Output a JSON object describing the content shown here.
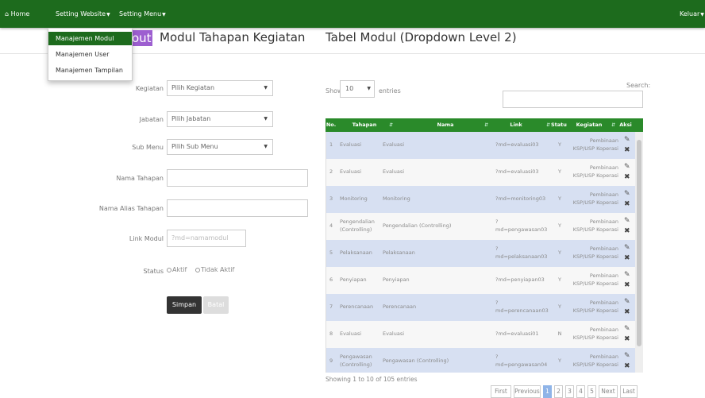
{
  "navbar": {
    "home": "Home",
    "setting_website": "Setting Website",
    "setting_menu": "Setting Menu",
    "logout": "Keluar"
  },
  "dropdown": {
    "items": [
      {
        "label": "Manajemen Modul",
        "active": true
      },
      {
        "label": "Manajemen User",
        "active": false
      },
      {
        "label": "Manajemen Tampilan",
        "active": false
      }
    ]
  },
  "headings": {
    "badge": "out",
    "form_title": "Modul Tahapan Kegiatan",
    "table_title": "Tabel Modul (Dropdown Level 2)"
  },
  "form": {
    "kegiatan_label": "Kegiatan",
    "kegiatan_value": "Pilih Kegiatan",
    "jabatan_label": "Jabatan",
    "jabatan_value": "Pilih Jabatan",
    "submenu_label": "Sub Menu",
    "submenu_value": "Pilih Sub Menu",
    "nama_tahapan_label": "Nama Tahapan",
    "nama_alias_label": "Nama Alias Tahapan",
    "link_modul_label": "Link Modul",
    "link_modul_placeholder": "?md=namamodul",
    "status_label": "Status",
    "status_aktif": "Aktif",
    "status_tidak_aktif": "Tidak Aktif",
    "save_button": "Simpan",
    "cancel_button": "Batal"
  },
  "table": {
    "show_label": "Show",
    "page_size": "10",
    "entries_label": "entries",
    "search_label": "Search:",
    "columns": [
      "No.",
      "Tahapan",
      "Nama",
      "Link",
      "Status",
      "Kegiatan",
      "Aksi"
    ],
    "rows": [
      {
        "no": "1",
        "tahapan": "Evaluasi",
        "nama": "Evaluasi",
        "link": "?md=evaluasi03",
        "status": "Y",
        "kegiatan": "Pembinaan KSP/USP Koperasi"
      },
      {
        "no": "2",
        "tahapan": "Evaluasi",
        "nama": "Evaluasi",
        "link": "?md=evaluasi03",
        "status": "Y",
        "kegiatan": "Pembinaan KSP/USP Koperasi"
      },
      {
        "no": "3",
        "tahapan": "Monitoring",
        "nama": "Monitoring",
        "link": "?md=monitoring03",
        "status": "Y",
        "kegiatan": "Pembinaan KSP/USP Koperasi"
      },
      {
        "no": "4",
        "tahapan": "Pengendalian (Controlling)",
        "nama": "Pengendalian (Controlling)",
        "link": "?md=pengawasan03",
        "status": "Y",
        "kegiatan": "Pembinaan KSP/USP Koperasi"
      },
      {
        "no": "5",
        "tahapan": "Pelaksanaan",
        "nama": "Pelaksanaan",
        "link": "?md=pelaksanaan03",
        "status": "Y",
        "kegiatan": "Pembinaan KSP/USP Koperasi"
      },
      {
        "no": "6",
        "tahapan": "Penyiapan",
        "nama": "Penyiapan",
        "link": "?md=penyiapan03",
        "status": "Y",
        "kegiatan": "Pembinaan KSP/USP Koperasi"
      },
      {
        "no": "7",
        "tahapan": "Perencanaan",
        "nama": "Perencanaan",
        "link": "?md=perencanaan03",
        "status": "Y",
        "kegiatan": "Pembinaan KSP/USP Koperasi"
      },
      {
        "no": "8",
        "tahapan": "Evaluasi",
        "nama": "Evaluasi",
        "link": "?md=evaluasi01",
        "status": "N",
        "kegiatan": "Pembinaan KSP/USP Koperasi"
      },
      {
        "no": "9",
        "tahapan": "Pengawasan (Controlling)",
        "nama": "Pengawasan (Controlling)",
        "link": "?md=pengawasan04",
        "status": "Y",
        "kegiatan": "Pembinaan KSP/USP Koperasi"
      }
    ],
    "showing_text": "Showing 1 to 10 of 105 entries",
    "pagination": [
      "First",
      "Previous",
      "1",
      "2",
      "3",
      "4",
      "5",
      "Next",
      "Last"
    ],
    "current_page": "1"
  },
  "colors": {
    "navbar": "#1d6b1d",
    "table_header": "#2a8a2a",
    "row_highlight": "#d7e0f2",
    "badge": "#9d5fd0",
    "current_page": "#8fb4e8"
  },
  "icons": {
    "home": "home-icon",
    "edit": "edit-icon",
    "delete": "delete-icon",
    "sort": "sort-icon",
    "caret": "caret-down-icon"
  }
}
